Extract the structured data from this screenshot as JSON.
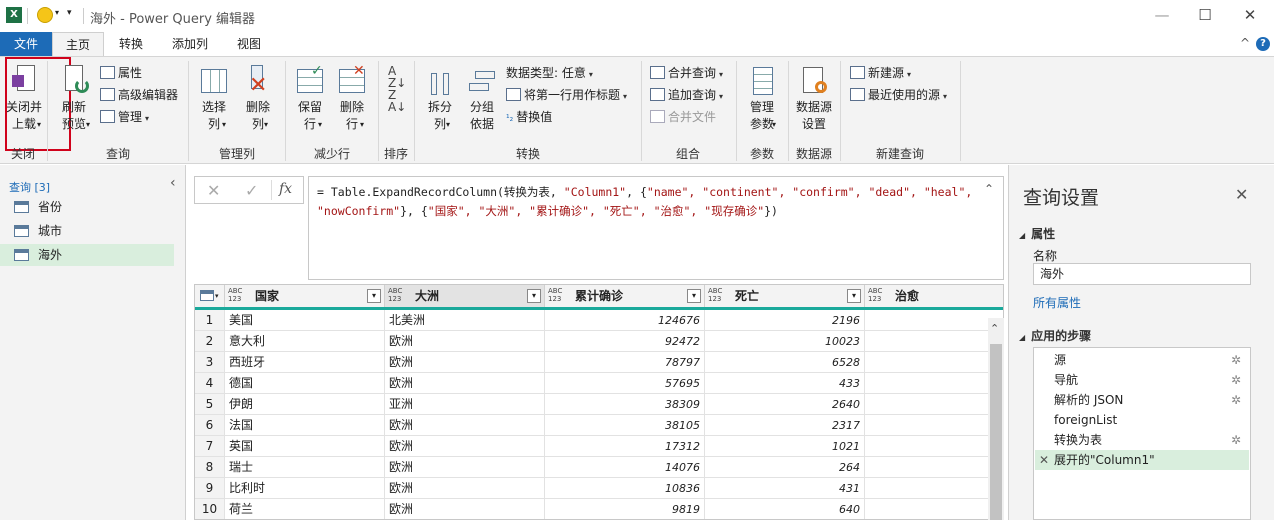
{
  "titlebar": {
    "title": "海外 - Power Query 编辑器",
    "min": "—",
    "max": "☐",
    "close": "✕"
  },
  "menu": {
    "tabs": [
      "文件",
      "主页",
      "转换",
      "添加列",
      "视图"
    ],
    "help": "?",
    "collapse": "^"
  },
  "ribbon": {
    "close_load": "关闭并\n上载",
    "refresh": "刷新\n预览",
    "properties": "属性",
    "adv_editor": "高级编辑器",
    "manage": "管理",
    "choose_cols": "选择\n列",
    "remove_cols": "删除\n列",
    "keep_rows": "保留\n行",
    "remove_rows": "删除\n行",
    "split_col": "拆分\n列",
    "group_by": "分组\n依据",
    "data_type": "数据类型: 任意",
    "first_row_header": "将第一行用作标题",
    "replace_values": "替换值",
    "merge_queries": "合并查询",
    "append_queries": "追加查询",
    "combine_files": "合并文件",
    "manage_params": "管理\n参数",
    "datasource_settings": "数据源\n设置",
    "new_source": "新建源",
    "recent_sources": "最近使用的源",
    "groups": [
      "关闭",
      "查询",
      "管理列",
      "减少行",
      "排序",
      "转换",
      "组合",
      "参数",
      "数据源",
      "新建查询"
    ]
  },
  "queries": {
    "header": "查询 [3]",
    "items": [
      "省份",
      "城市",
      "海外"
    ]
  },
  "formula": {
    "prefix": "= Table.ExpandRecordColumn(转换为表, ",
    "s1": "\"Column1\"",
    "mid1": ", {",
    "s2": "\"name\", \"continent\", \"confirm\", \"dead\", \"heal\", \"nowConfirm\"",
    "mid2": "}, {",
    "s3": "\"国家\", \"大洲\", \"累计确诊\", \"死亡\", \"治愈\", \"现存确诊\"",
    "suffix": "})",
    "cancel": "✕",
    "accept": "✓",
    "fx": "fx"
  },
  "table": {
    "columns": [
      "国家",
      "大洲",
      "累计确诊",
      "死亡",
      "治愈"
    ],
    "type_label": "ABC\n123",
    "rows": [
      [
        "1",
        "美国",
        "北美洲",
        "124676",
        "2196"
      ],
      [
        "2",
        "意大利",
        "欧洲",
        "92472",
        "10023"
      ],
      [
        "3",
        "西班牙",
        "欧洲",
        "78797",
        "6528"
      ],
      [
        "4",
        "德国",
        "欧洲",
        "57695",
        "433"
      ],
      [
        "5",
        "伊朗",
        "亚洲",
        "38309",
        "2640"
      ],
      [
        "6",
        "法国",
        "欧洲",
        "38105",
        "2317"
      ],
      [
        "7",
        "英国",
        "欧洲",
        "17312",
        "1021"
      ],
      [
        "8",
        "瑞士",
        "欧洲",
        "14076",
        "264"
      ],
      [
        "9",
        "比利时",
        "欧洲",
        "10836",
        "431"
      ],
      [
        "10",
        "荷兰",
        "欧洲",
        "9819",
        "640"
      ]
    ]
  },
  "settings": {
    "title": "查询设置",
    "properties": "属性",
    "name_label": "名称",
    "name_value": "海外",
    "all_props": "所有属性",
    "applied_steps": "应用的步骤",
    "steps": [
      "源",
      "导航",
      "解析的 JSON",
      "foreignList",
      "转换为表",
      "展开的\"Column1\""
    ]
  },
  "colors": {
    "accent": "#1d6bb7",
    "teal": "#1aa99b",
    "highlight": "#d9eedd",
    "red_box": "#d0021b",
    "link": "#1d6bb7"
  }
}
